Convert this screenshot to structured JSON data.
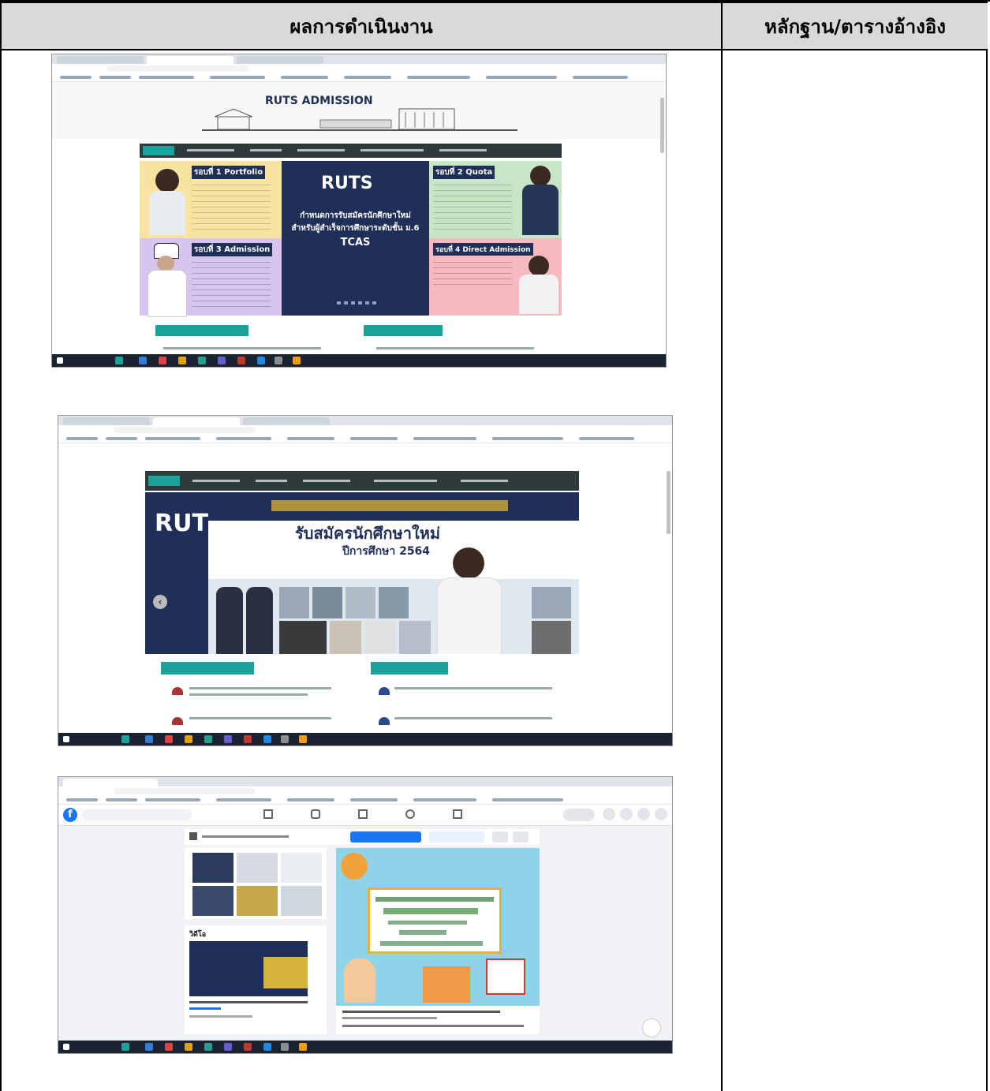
{
  "table": {
    "col1_header": "ผลการดำเนินงาน",
    "col2_header": "หลักฐาน/ตารางอ้างอิง"
  },
  "shot1": {
    "site_title": "RUTS ADMISSION",
    "logo": "RUTS",
    "center_text_1": "กำหนดการรับสมัครนักศึกษาใหม่",
    "center_text_2": "สำหรับผู้สำเร็จการศึกษาระดับชั้น ม.6",
    "center_text_3": "TCAS",
    "round1": "รอบที่ 1 Portfolio",
    "round2": "รอบที่ 2 Quota",
    "round3": "รอบที่ 3 Admission",
    "round4": "รอบที่ 4 Direct Admission"
  },
  "shot2": {
    "logo": "RUTS",
    "headline": "รับสมัครนักศึกษาใหม่",
    "year": "ปีการศึกษา 2564"
  },
  "shot3": {
    "section_label": "วิดีโอ"
  },
  "colors": {
    "header_bg": "#d9d9d9",
    "ruts_navy": "#1f2f57",
    "nav_green": "#2f3a3a",
    "teal_button": "#1aa39a",
    "facebook_blue": "#1877f2"
  }
}
